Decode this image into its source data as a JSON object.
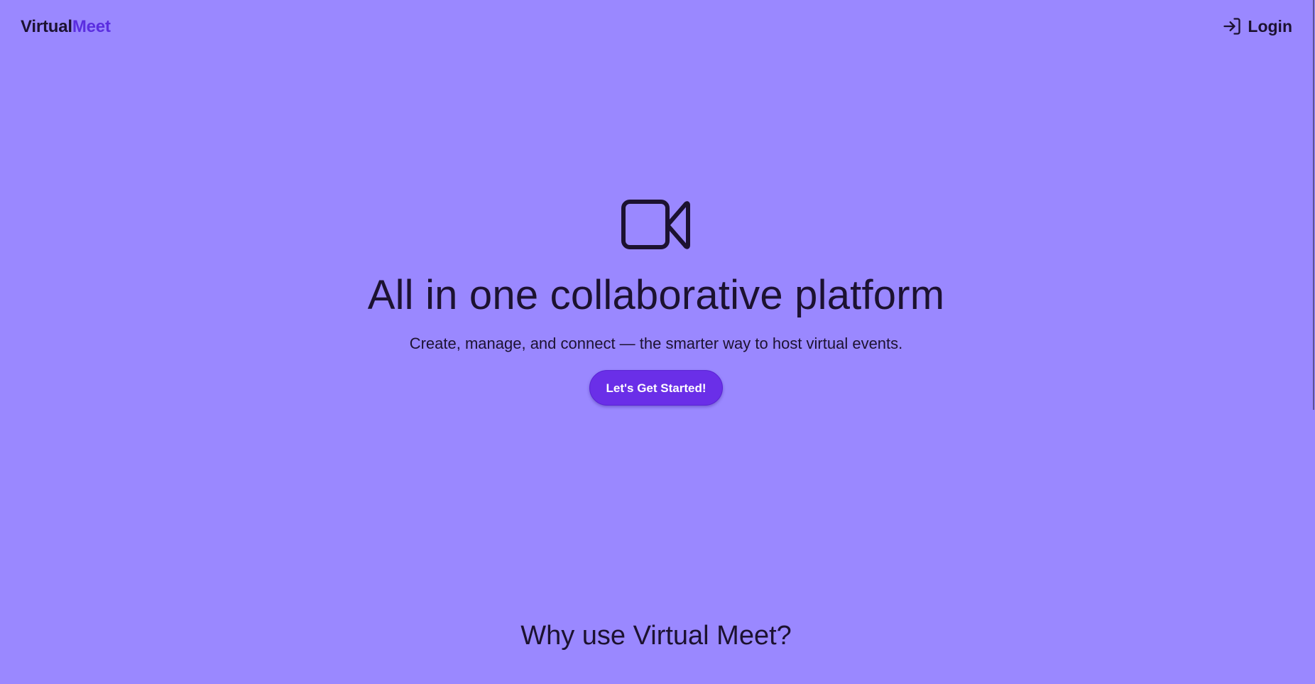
{
  "nav": {
    "brand_part1": "Virtual",
    "brand_part2": "Meet",
    "login_label": "Login",
    "login_icon": "login-arrow-icon"
  },
  "hero": {
    "icon": "video-camera-icon",
    "title": "All in one collaborative platform",
    "subtitle": "Create, manage, and connect — the smarter way to host virtual events.",
    "cta_label": "Let's Get Started!"
  },
  "section": {
    "why_title": "Why use Virtual Meet?"
  },
  "colors": {
    "background": "#9a88ff",
    "accent": "#6a2fe8",
    "brand_accent": "#5b2ee0",
    "text": "#1c1230"
  }
}
